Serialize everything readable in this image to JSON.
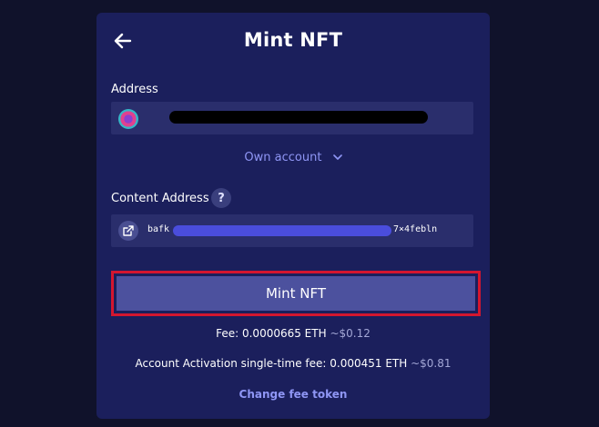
{
  "header": {
    "title": "Mint NFT",
    "back_icon": "arrow-left-icon"
  },
  "address": {
    "label": "Address",
    "avatar_icon": "account-avatar-icon",
    "value_redacted": true
  },
  "account_selector": {
    "label": "Own account",
    "icon": "chevron-down-icon"
  },
  "content_address": {
    "label": "Content Address",
    "help_label": "?",
    "link_icon": "external-link-icon",
    "prefix": "bafk",
    "suffix": "7×4febln",
    "value_redacted": true
  },
  "mint_button": {
    "label": "Mint NFT"
  },
  "fees": {
    "fee_label": "Fee: 0.0000665 ETH",
    "fee_usd": "~$0.12",
    "activation_label": "Account Activation single-time fee: 0.000451 ETH",
    "activation_usd": "~$0.81",
    "change_token_label": "Change fee token"
  },
  "colors": {
    "background": "#10122b",
    "panel": "#1b1f5c",
    "field": "#2a2e6c",
    "accent": "#8f96f5",
    "button": "#4c519e",
    "highlight": "#d4162f"
  }
}
